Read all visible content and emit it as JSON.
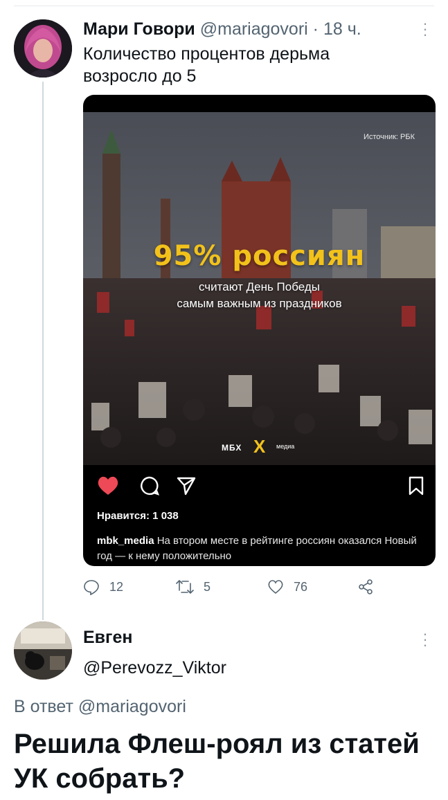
{
  "tweet": {
    "author_name": "Мари Говори",
    "author_handle": "@mariagovori",
    "separator": "·",
    "time": "18 ч.",
    "text": "Количество процентов дерьма возросло до 5",
    "menu_icon": "more-vertical-icon",
    "embed": {
      "source": "Источник: РБК",
      "headline": "95% россиян",
      "subline_1": "считают День Победы",
      "subline_2": "самым важным из праздников",
      "logo_text": "МБХ",
      "logo_mark": "X",
      "logo_small": "медиа",
      "likes_text": "Нравится: 1 038",
      "caption_user": "mbk_media",
      "caption_text": "На втором месте в рейтинге россиян оказался Новый год — к нему положительно",
      "heart_color": "#ed4956",
      "headline_color": "#f2c21b"
    },
    "actions": {
      "replies": "12",
      "retweets": "5",
      "likes": "76"
    }
  },
  "reply": {
    "author_name": "Евген",
    "author_handle": "@Perevozz_Viktor",
    "reply_prefix": "В ответ",
    "reply_mention": "@mariagovori",
    "text": "Решила Флеш-роял из статей УК собрать?"
  },
  "colors": {
    "text_primary": "#0f1419",
    "text_secondary": "#536471",
    "divider": "#cfd9de"
  }
}
